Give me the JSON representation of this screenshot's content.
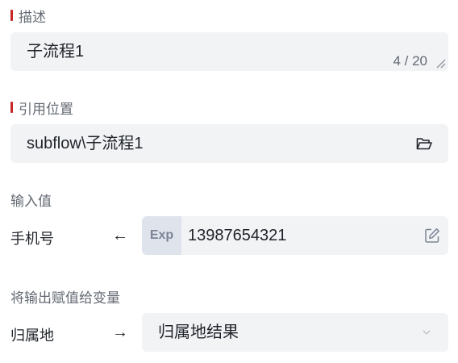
{
  "description": {
    "label": "描述",
    "value": "子流程1",
    "counter": "4 / 20"
  },
  "reference": {
    "label": "引用位置",
    "value": "subflow\\子流程1",
    "icon": "folder-open-icon"
  },
  "input": {
    "section_label": "输入值",
    "param_name": "手机号",
    "arrow": "←",
    "badge": "Exp",
    "value": "13987654321",
    "icon": "edit-icon"
  },
  "output": {
    "section_label": "将输出赋值给变量",
    "param_name": "归属地",
    "arrow": "→",
    "selected": "归属地结果",
    "icon": "chevron-down-icon"
  },
  "colors": {
    "required": "#c62828",
    "field_bg": "#f2f3f5",
    "badge_bg": "#dfe3ec"
  }
}
